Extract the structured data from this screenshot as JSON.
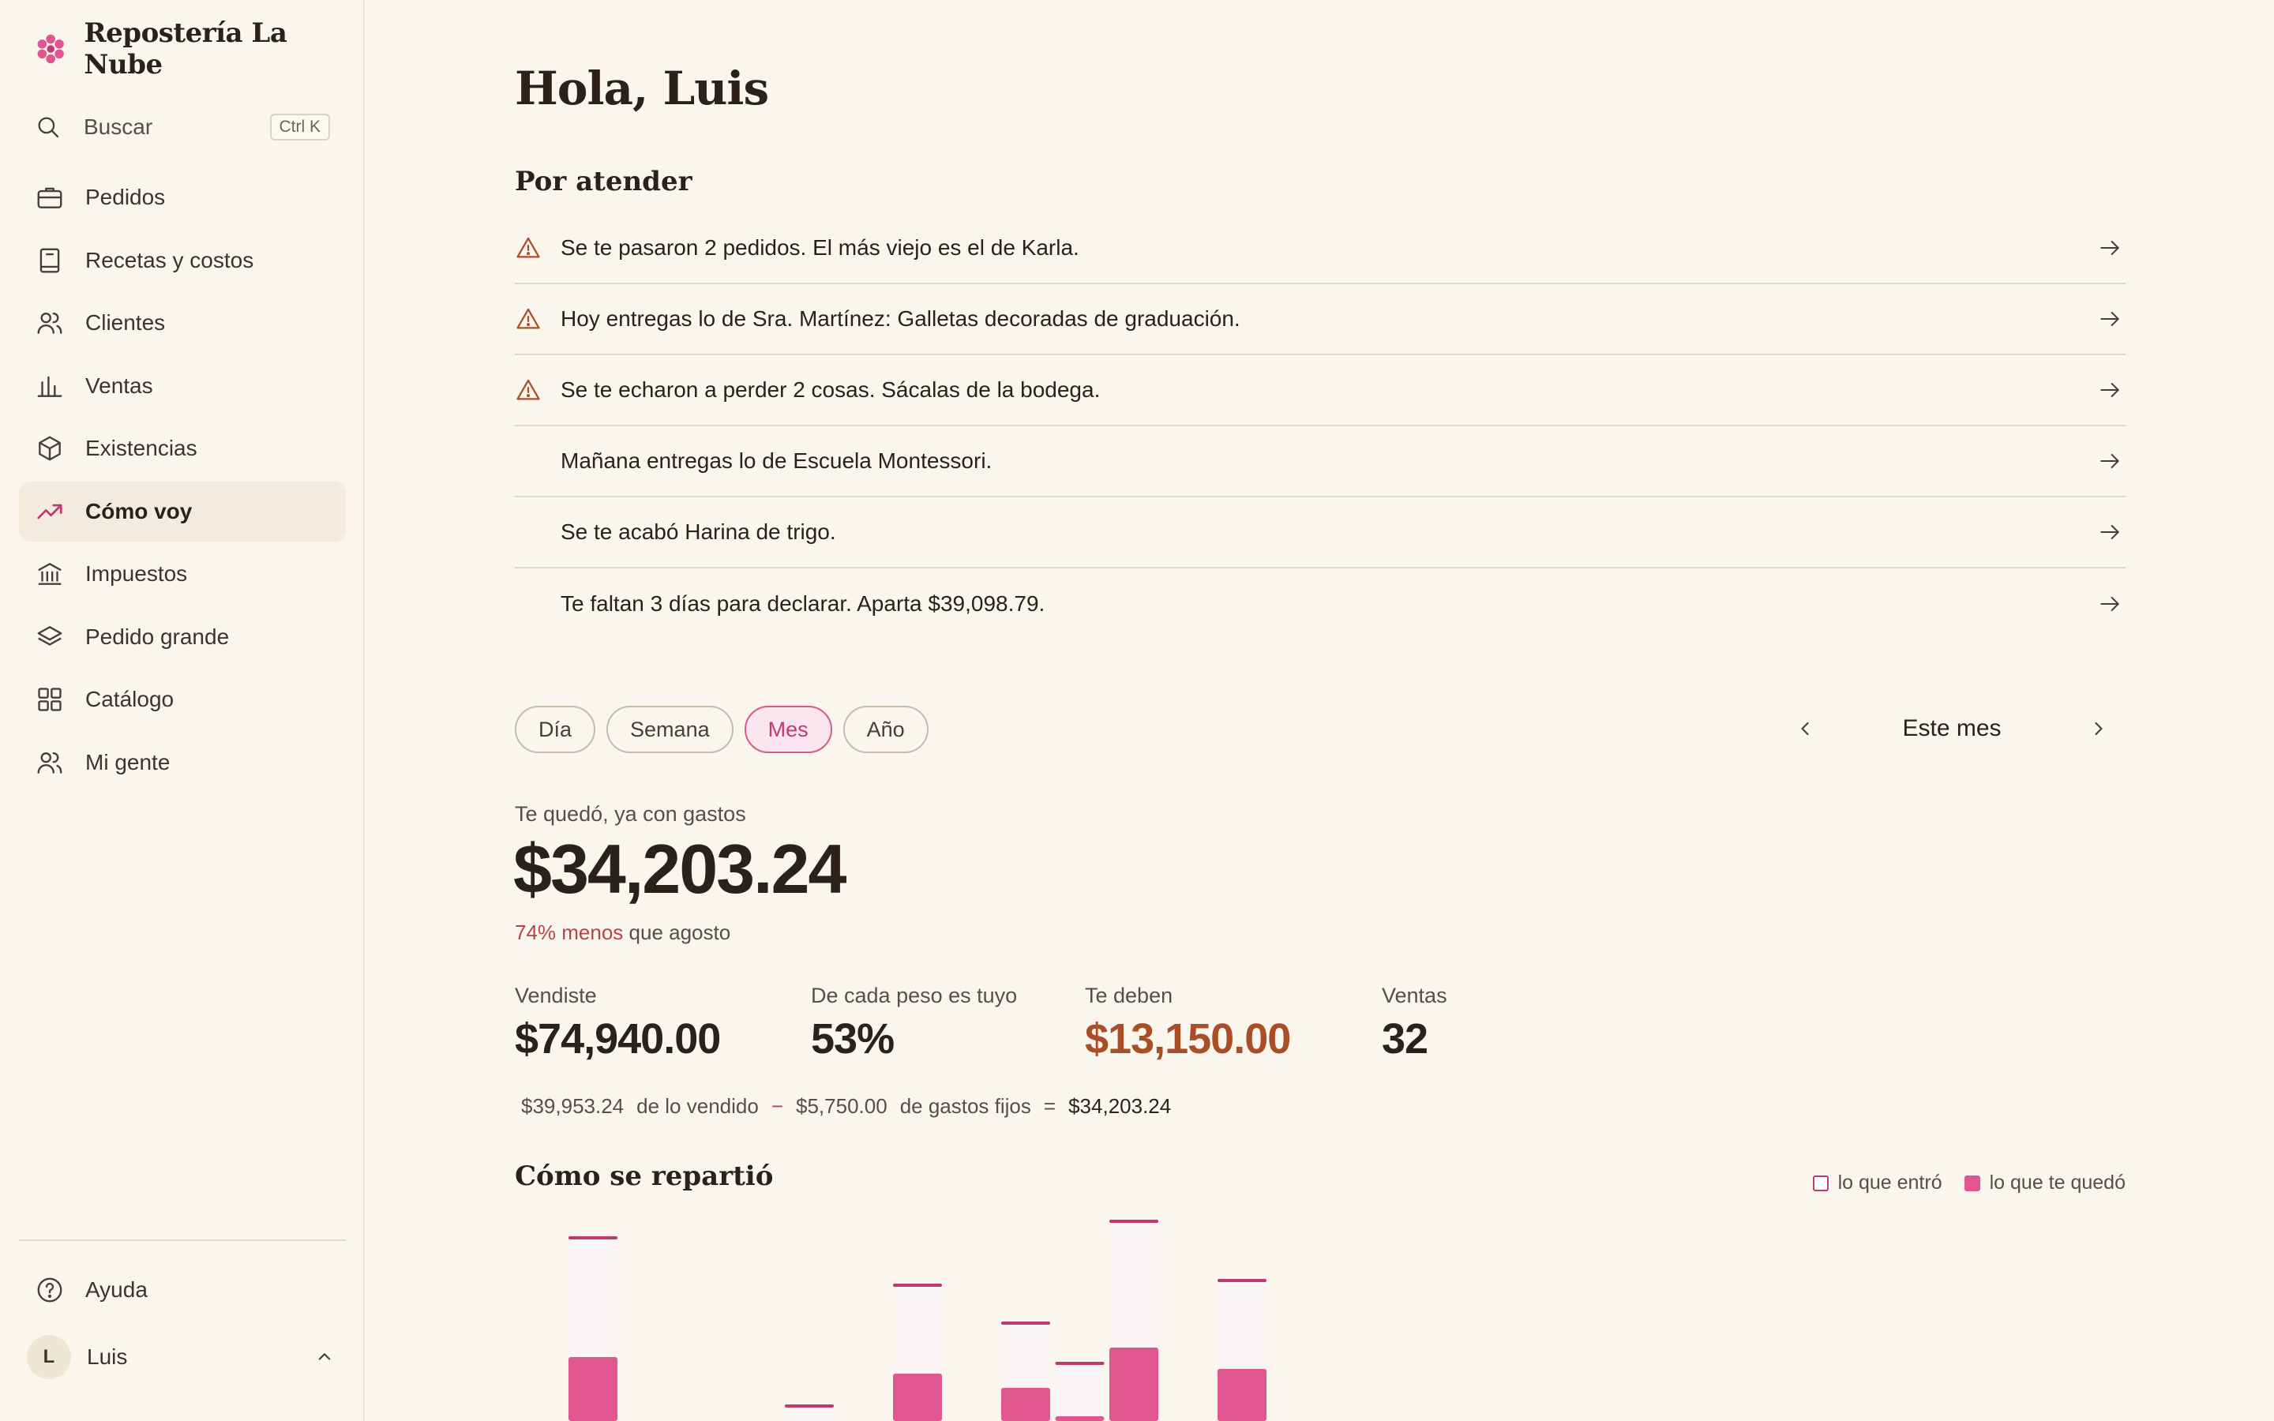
{
  "brand": {
    "name": "Repostería La Nube",
    "logo_icon": "flower-logo-icon",
    "accent": "#e0578f"
  },
  "search": {
    "label": "Buscar",
    "shortcut": "Ctrl K"
  },
  "sidebar": {
    "items": [
      {
        "label": "Pedidos",
        "icon": "briefcase-icon",
        "active": false
      },
      {
        "label": "Recetas y costos",
        "icon": "book-icon",
        "active": false
      },
      {
        "label": "Clientes",
        "icon": "users-icon",
        "active": false
      },
      {
        "label": "Ventas",
        "icon": "bar-chart-icon",
        "active": false
      },
      {
        "label": "Existencias",
        "icon": "box-icon",
        "active": false
      },
      {
        "label": "Cómo voy",
        "icon": "trending-up-icon",
        "active": true
      },
      {
        "label": "Impuestos",
        "icon": "bank-icon",
        "active": false
      },
      {
        "label": "Pedido grande",
        "icon": "layers-icon",
        "active": false
      },
      {
        "label": "Catálogo",
        "icon": "grid-icon",
        "active": false
      },
      {
        "label": "Mi gente",
        "icon": "team-icon",
        "active": false
      }
    ],
    "help": "Ayuda",
    "user": {
      "initial": "L",
      "name": "Luis"
    }
  },
  "main": {
    "greeting": "Hola, Luis",
    "todo_title": "Por atender",
    "alerts": [
      {
        "text": "Se te pasaron 2 pedidos. El más viejo es el de Karla.",
        "warning": true
      },
      {
        "text": "Hoy entregas lo de Sra. Martínez: Galletas decoradas de graduación.",
        "warning": true
      },
      {
        "text": "Se te echaron a perder 2 cosas. Sácalas de la bodega.",
        "warning": true
      },
      {
        "text": "Mañana entregas lo de Escuela Montessori.",
        "warning": false
      },
      {
        "text": "Se te acabó Harina de trigo.",
        "warning": false
      },
      {
        "text": "Te faltan 3 días para declarar. Aparta $39,098.79.",
        "warning": false
      }
    ],
    "tabs": [
      {
        "label": "Día",
        "active": false
      },
      {
        "label": "Semana",
        "active": false
      },
      {
        "label": "Mes",
        "active": true
      },
      {
        "label": "Año",
        "active": false
      }
    ],
    "period_label": "Este mes",
    "profit_label": "Te quedó, ya con gastos",
    "profit_value": "$34,203.24",
    "delta_neg": "74% menos",
    "delta_rest": " que agosto",
    "stats": {
      "sold": {
        "label": "Vendiste",
        "value": "$74,940.00"
      },
      "share": {
        "label": "De cada peso es tuyo",
        "value": "53%"
      },
      "owed": {
        "label": "Te deben",
        "value": "$13,150.00"
      },
      "sales": {
        "label": "Ventas",
        "value": "32"
      }
    },
    "breakdown": {
      "sold_amount": "$39,953.24",
      "sold_text": "de lo vendido",
      "minus": "−",
      "fixed_amount": "$5,750.00",
      "fixed_text": "de gastos fijos",
      "equals": "=",
      "total": "$34,203.24"
    },
    "chart_title": "Cómo se repartió",
    "legend": {
      "in": "lo que entró",
      "kept": "lo que te quedó"
    }
  },
  "chart_data": {
    "type": "bar",
    "series": [
      {
        "name": "lo que entró",
        "values": [
          0.78,
          0,
          0,
          0,
          0.07,
          0,
          0.58,
          0,
          0.42,
          0.25,
          0.85,
          0,
          0.6
        ]
      },
      {
        "name": "lo que te quedó",
        "values": [
          0.27,
          0,
          0,
          0,
          0,
          0,
          0.2,
          0,
          0.14,
          0.02,
          0.31,
          0,
          0.22
        ]
      }
    ],
    "colors": {
      "in": "#fbf4f5",
      "in_top": "#c0396f",
      "kept": "#e0578f"
    }
  }
}
